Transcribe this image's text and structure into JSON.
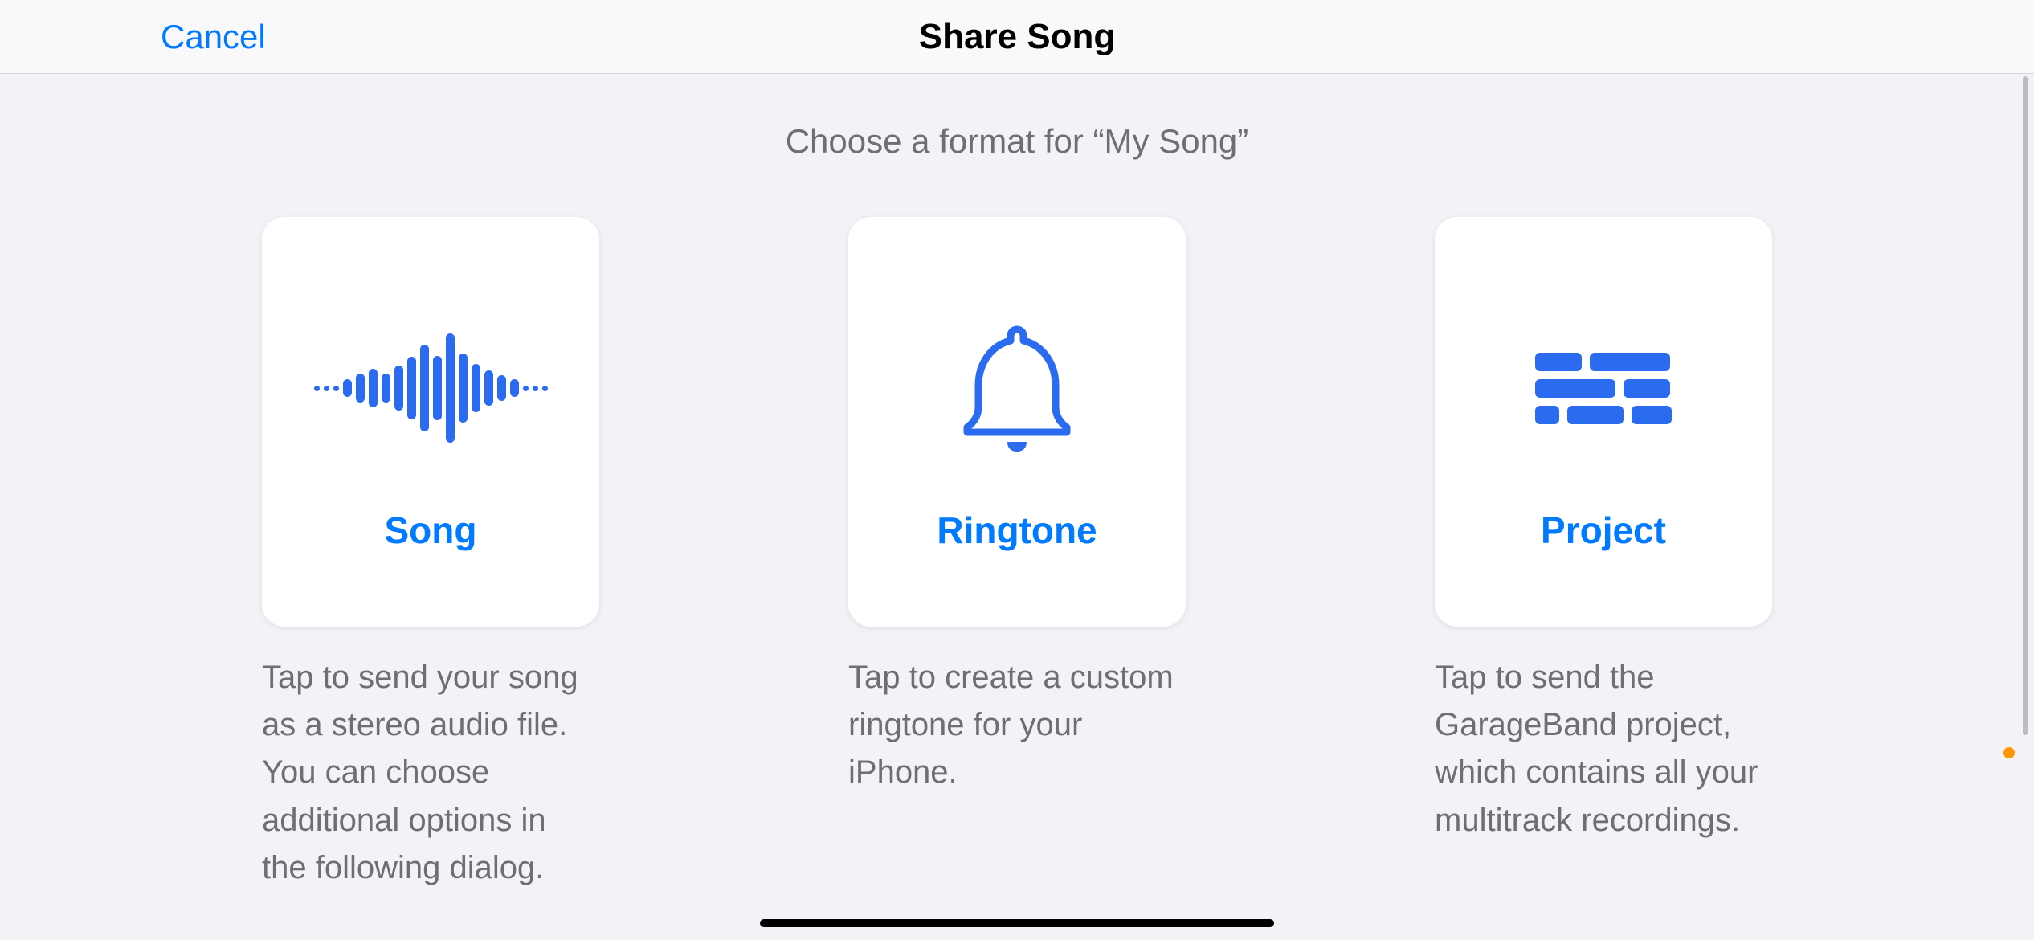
{
  "navbar": {
    "cancel": "Cancel",
    "title": "Share Song"
  },
  "subtitle": "Choose a format for “My Song”",
  "options": {
    "song": {
      "label": "Song",
      "desc": "Tap to send your song as a stereo audio file. You can choose additional options in the following dialog."
    },
    "ringtone": {
      "label": "Ringtone",
      "desc": "Tap to create a custom ringtone for your iPhone."
    },
    "project": {
      "label": "Project",
      "desc": "Tap to send the GarageBand project, which contains all your multitrack recordings."
    }
  }
}
